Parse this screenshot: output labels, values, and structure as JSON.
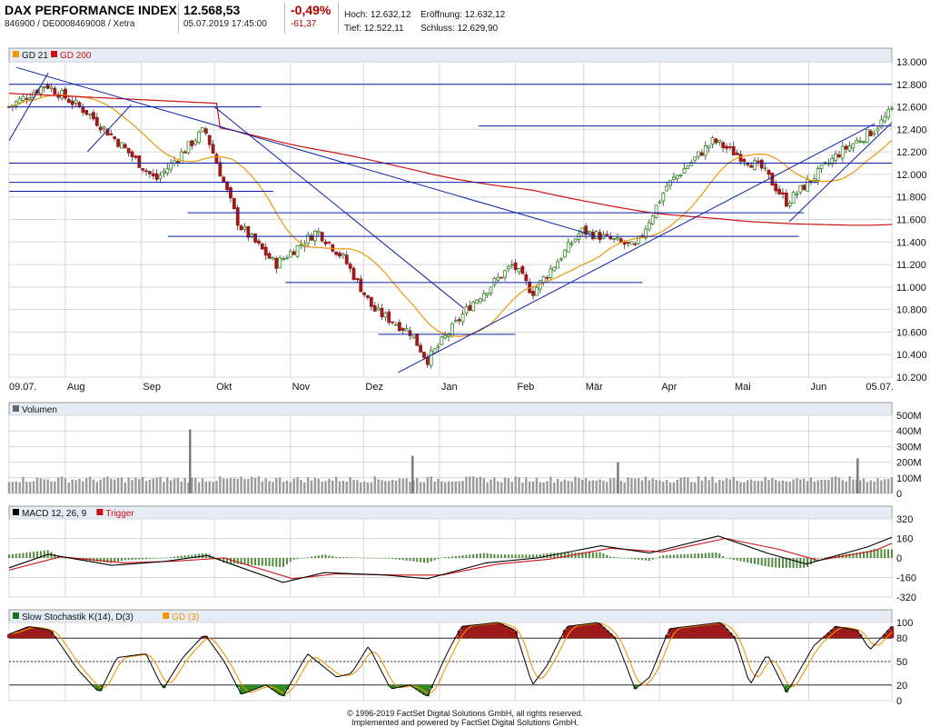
{
  "header": {
    "title": "DAX PERFORMANCE INDEX",
    "identifiers": "846900 / DE0008469008 / Xetra",
    "price": "12.568,53",
    "datetime": "05.07.2019 17:45:00",
    "change_pct": "-0,49%",
    "change_abs": "-61,37",
    "high_label": "Hoch:",
    "high": "12.632,12",
    "open_label": "Eröffnung:",
    "open": "12.632,12",
    "low_label": "Tief:",
    "low": "12.522,11",
    "close_label": "Schluss:",
    "close": "12.629,90"
  },
  "colors": {
    "up": "#2e8b1e",
    "down": "#9e1a1a",
    "gd21": "#f0960a",
    "gd200": "#cc1111",
    "trend": "#0a1fa8",
    "legend_bg": "#e6ecf5",
    "grid": "#d7d7d7",
    "macd_hist": "#4f8a3d"
  },
  "footer": {
    "line1": "© 1996-2019 FactSet Digital Solutions GmbH, all rights reserved.",
    "line2": "Implemented and powered by FactSet Digital Solutions GmbH."
  },
  "chart_data": [
    {
      "type": "candlestick",
      "legend": [
        "GD 21",
        "GD 200"
      ],
      "ylim": [
        10200,
        13000
      ],
      "y_ticks": [
        "13.000",
        "12.800",
        "12.600",
        "12.400",
        "12.200",
        "12.000",
        "11.800",
        "11.600",
        "11.400",
        "11.200",
        "11.000",
        "10.800",
        "10.600",
        "10.400",
        "10.200"
      ],
      "x_tick_labels": [
        "09.07.",
        "Aug",
        "Sep",
        "Okt",
        "Nov",
        "Dez",
        "Jan",
        "Feb",
        "Mär",
        "Apr",
        "Mai",
        "Jun",
        "05.07."
      ],
      "approx_close_path": [
        [
          "2018-07-09",
          12600
        ],
        [
          "2018-07-24",
          12800
        ],
        [
          "2018-08-10",
          12550
        ],
        [
          "2018-08-22",
          12300
        ],
        [
          "2018-09-07",
          11950
        ],
        [
          "2018-09-27",
          12400
        ],
        [
          "2018-10-11",
          11550
        ],
        [
          "2018-10-26",
          11200
        ],
        [
          "2018-11-12",
          11500
        ],
        [
          "2018-11-23",
          11250
        ],
        [
          "2018-12-05",
          10800
        ],
        [
          "2018-12-20",
          10600
        ],
        [
          "2018-12-27",
          10350
        ],
        [
          "2019-01-14",
          10850
        ],
        [
          "2019-01-31",
          11200
        ],
        [
          "2019-02-08",
          10950
        ],
        [
          "2019-02-28",
          11500
        ],
        [
          "2019-03-08",
          11450
        ],
        [
          "2019-03-22",
          11350
        ],
        [
          "2019-04-04",
          11900
        ],
        [
          "2019-04-23",
          12300
        ],
        [
          "2019-05-13",
          12050
        ],
        [
          "2019-05-23",
          11750
        ],
        [
          "2019-06-14",
          12200
        ],
        [
          "2019-06-28",
          12400
        ],
        [
          "2019-07-05",
          12570
        ]
      ]
    },
    {
      "type": "bar",
      "legend": [
        "Volumen"
      ],
      "ylim": [
        0,
        500
      ],
      "y_ticks": [
        "500M",
        "400M",
        "300M",
        "200M",
        "100M",
        "0"
      ],
      "notable_values_M": [
        [
          "2018-09-21",
          410
        ],
        [
          "2018-12-21",
          240
        ],
        [
          "2019-03-15",
          200
        ],
        [
          "2019-06-21",
          225
        ]
      ]
    },
    {
      "type": "line",
      "legend": [
        "MACD 12, 26, 9",
        "Trigger"
      ],
      "ylim": [
        -320,
        320
      ],
      "y_ticks": [
        "320",
        "160",
        "0",
        "-160",
        "-320"
      ],
      "series": [
        {
          "name": "MACD 12, 26, 9",
          "points": [
            [
              "2018-07-09",
              -80
            ],
            [
              "2018-07-25",
              30
            ],
            [
              "2018-08-20",
              -60
            ],
            [
              "2018-09-10",
              -30
            ],
            [
              "2018-09-28",
              20
            ],
            [
              "2018-10-29",
              -200
            ],
            [
              "2018-11-15",
              -120
            ],
            [
              "2018-12-10",
              -140
            ],
            [
              "2018-12-27",
              -170
            ],
            [
              "2019-01-20",
              -40
            ],
            [
              "2019-02-10",
              0
            ],
            [
              "2019-03-08",
              100
            ],
            [
              "2019-03-28",
              40
            ],
            [
              "2019-04-25",
              180
            ],
            [
              "2019-05-15",
              40
            ],
            [
              "2019-05-31",
              -50
            ],
            [
              "2019-06-25",
              90
            ],
            [
              "2019-07-05",
              170
            ]
          ]
        },
        {
          "name": "Trigger",
          "points": [
            [
              "2018-07-09",
              -100
            ],
            [
              "2018-07-30",
              10
            ],
            [
              "2018-08-25",
              -40
            ],
            [
              "2018-09-15",
              -25
            ],
            [
              "2018-10-05",
              0
            ],
            [
              "2018-11-02",
              -170
            ],
            [
              "2018-11-20",
              -130
            ],
            [
              "2018-12-15",
              -140
            ],
            [
              "2019-01-02",
              -140
            ],
            [
              "2019-01-25",
              -50
            ],
            [
              "2019-02-15",
              -10
            ],
            [
              "2019-03-12",
              80
            ],
            [
              "2019-04-02",
              50
            ],
            [
              "2019-04-28",
              160
            ],
            [
              "2019-05-20",
              70
            ],
            [
              "2019-06-05",
              -20
            ],
            [
              "2019-06-28",
              60
            ],
            [
              "2019-07-05",
              120
            ]
          ]
        }
      ]
    },
    {
      "type": "line",
      "legend": [
        "Slow Stochastik K(14), D(3)",
        "GD (3)"
      ],
      "ylim": [
        0,
        100
      ],
      "y_ticks": [
        "100",
        "80",
        "50",
        "20",
        "0"
      ],
      "reference_lines": [
        80,
        50,
        20
      ],
      "series": [
        {
          "name": "Slow Stochastik K(14), D(3)",
          "points": [
            [
              "2018-07-09",
              85
            ],
            [
              "2018-07-17",
              95
            ],
            [
              "2018-07-26",
              90
            ],
            [
              "2018-08-06",
              40
            ],
            [
              "2018-08-15",
              10
            ],
            [
              "2018-08-22",
              55
            ],
            [
              "2018-09-03",
              60
            ],
            [
              "2018-09-10",
              15
            ],
            [
              "2018-09-18",
              55
            ],
            [
              "2018-09-27",
              85
            ],
            [
              "2018-10-05",
              50
            ],
            [
              "2018-10-12",
              8
            ],
            [
              "2018-10-22",
              20
            ],
            [
              "2018-10-29",
              5
            ],
            [
              "2018-11-08",
              60
            ],
            [
              "2018-11-20",
              30
            ],
            [
              "2018-11-26",
              35
            ],
            [
              "2018-12-03",
              70
            ],
            [
              "2018-12-12",
              15
            ],
            [
              "2018-12-20",
              20
            ],
            [
              "2018-12-27",
              5
            ],
            [
              "2019-01-04",
              60
            ],
            [
              "2019-01-10",
              95
            ],
            [
              "2019-01-25",
              100
            ],
            [
              "2019-02-01",
              90
            ],
            [
              "2019-02-08",
              20
            ],
            [
              "2019-02-14",
              45
            ],
            [
              "2019-02-22",
              95
            ],
            [
              "2019-03-07",
              100
            ],
            [
              "2019-03-14",
              80
            ],
            [
              "2019-03-22",
              15
            ],
            [
              "2019-03-28",
              30
            ],
            [
              "2019-04-05",
              92
            ],
            [
              "2019-04-26",
              100
            ],
            [
              "2019-05-02",
              80
            ],
            [
              "2019-05-08",
              20
            ],
            [
              "2019-05-15",
              60
            ],
            [
              "2019-05-23",
              10
            ],
            [
              "2019-06-03",
              70
            ],
            [
              "2019-06-12",
              95
            ],
            [
              "2019-06-21",
              90
            ],
            [
              "2019-06-26",
              65
            ],
            [
              "2019-07-05",
              95
            ]
          ]
        }
      ]
    }
  ]
}
